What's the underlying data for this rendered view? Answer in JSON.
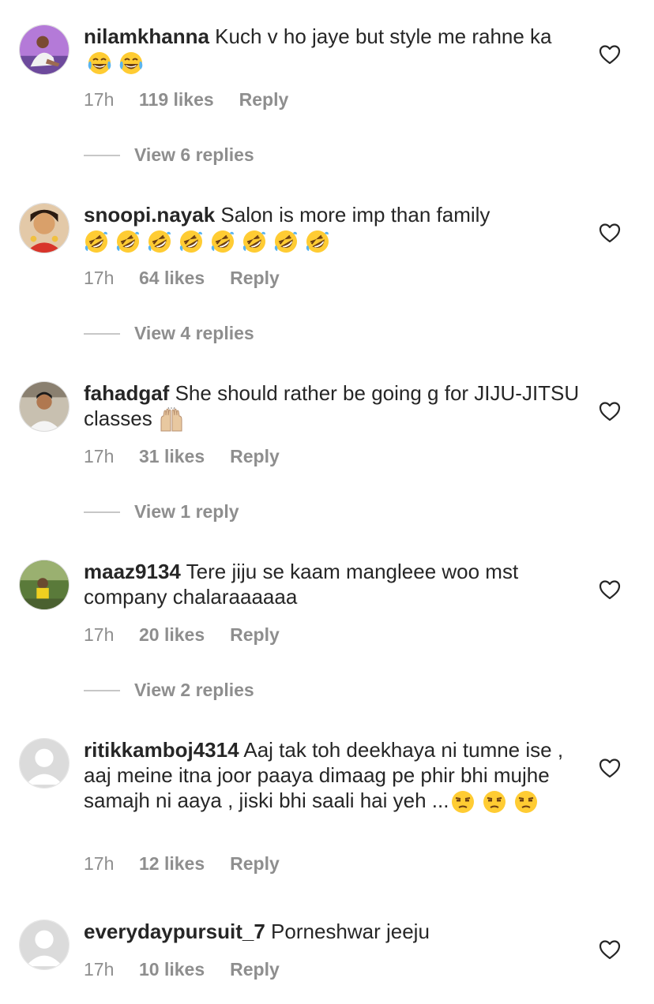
{
  "comments": [
    {
      "username": "nilamkhanna",
      "text": "Kuch v ho jaye but style me rahne ka",
      "emoji": [
        "face-with-tears-of-joy",
        "face-with-tears-of-joy"
      ],
      "time": "17h",
      "likes": "119 likes",
      "reply": "Reply",
      "view_replies": "View 6 replies"
    },
    {
      "username": "snoopi.nayak",
      "text": "Salon is more imp than family",
      "emoji": [
        "rolling-on-floor-laughing",
        "rolling-on-floor-laughing",
        "rolling-on-floor-laughing",
        "rolling-on-floor-laughing",
        "rolling-on-floor-laughing",
        "rolling-on-floor-laughing",
        "rolling-on-floor-laughing",
        "rolling-on-floor-laughing"
      ],
      "time": "17h",
      "likes": "64 likes",
      "reply": "Reply",
      "view_replies": "View 4 replies"
    },
    {
      "username": "fahadgaf",
      "text": "She should rather be going g for JIJU-JITSU classes",
      "emoji": [
        "raising-hands"
      ],
      "time": "17h",
      "likes": "31 likes",
      "reply": "Reply",
      "view_replies": "View 1 reply"
    },
    {
      "username": "maaz9134",
      "text": "Tere jiju se kaam mangleee woo mst company chalaraaaaaa",
      "emoji": [],
      "time": "17h",
      "likes": "20 likes",
      "reply": "Reply",
      "view_replies": "View 2 replies"
    },
    {
      "username": "ritikkamboj4314",
      "text": "Aaj tak toh deekhaya ni tumne ise , aaj meine itna joor paaya dimaag pe phir bhi mujhe samajh ni aaya , jiski bhi saali hai yeh ...",
      "emoji": [
        "unamused-face",
        "unamused-face",
        "unamused-face"
      ],
      "time": "17h",
      "likes": "12 likes",
      "reply": "Reply"
    },
    {
      "username": "everydaypursuit_7",
      "text": "Porneshwar jeeju",
      "emoji": [],
      "time": "17h",
      "likes": "10 likes",
      "reply": "Reply"
    }
  ],
  "icons": {
    "like": "heart-outline-icon",
    "default_avatar": "default-avatar-icon"
  },
  "colors": {
    "text": "#262626",
    "secondary": "#8e8e8e",
    "divider": "#c7c7c7"
  }
}
